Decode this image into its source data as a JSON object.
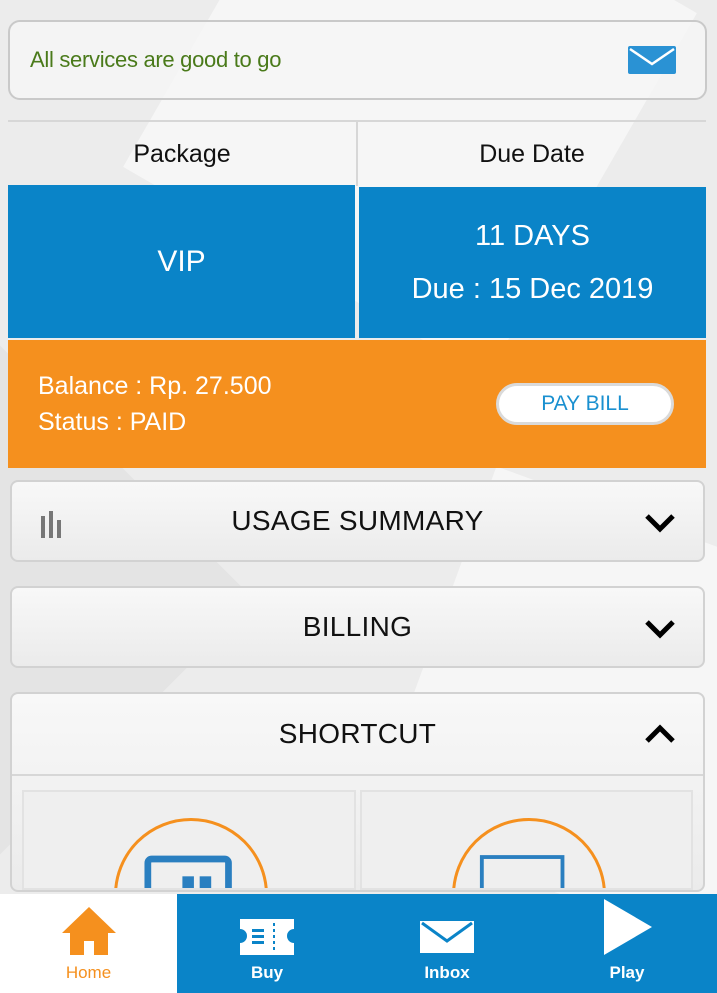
{
  "notice": {
    "text": "All services are good to go",
    "icon": "mail-icon"
  },
  "plan": {
    "package_label": "Package",
    "due_label": "Due Date",
    "package_value": "VIP",
    "days_left": "11 DAYS",
    "due_text": "Due : 15 Dec 2019"
  },
  "balance": {
    "balance_text": "Balance : Rp. 27.500",
    "status_text": "Status : PAID",
    "pay_label": "PAY BILL"
  },
  "sections": {
    "usage": "USAGE SUMMARY",
    "billing": "BILLING",
    "shortcut": "SHORTCUT"
  },
  "nav": [
    {
      "label": "Home",
      "icon": "home-icon",
      "active": true
    },
    {
      "label": "Buy",
      "icon": "ticket-icon",
      "active": false
    },
    {
      "label": "Inbox",
      "icon": "mail-icon",
      "active": false
    },
    {
      "label": "Play",
      "icon": "play-icon",
      "active": false
    }
  ],
  "colors": {
    "blue": "#0a84c8",
    "orange": "#f5901e",
    "notice_green": "#4a7a1a"
  }
}
